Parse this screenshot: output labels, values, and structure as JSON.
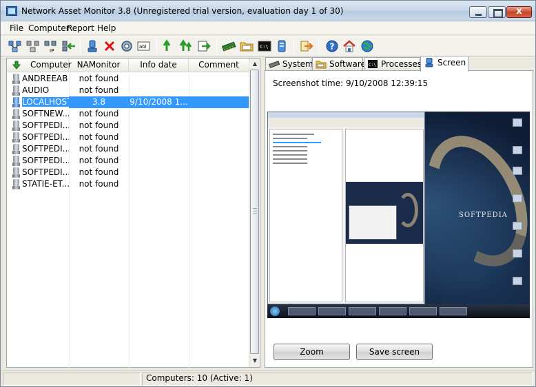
{
  "window": {
    "title": "Network Asset Monitor 3.8 (Unregistered trial version, evaluation day 1 of 30)",
    "close_glyph": "x"
  },
  "menu": [
    "File",
    "Computer",
    "Report",
    "Help"
  ],
  "toolbar": {
    "icons": [
      "network-scan-icon",
      "remove-computers-icon",
      "add-by-ip-icon",
      "import-computers-icon",
      "computer-icon",
      "delete-icon",
      "settings-icon",
      "rename-icon",
      "refresh-icon",
      "refresh-all-icon",
      "export-icon",
      "memory-icon",
      "folder-icon",
      "console-icon",
      "server-icon",
      "exit-icon",
      "help-icon",
      "home-icon",
      "web-icon"
    ]
  },
  "list": {
    "columns": [
      "Computer",
      "NAMonitor",
      "Info date",
      "Comment"
    ],
    "rows": [
      {
        "computer": "ANDREEAB",
        "namonitor": "not found",
        "info_date": "",
        "comment": "",
        "selected": false
      },
      {
        "computer": "AUDIO",
        "namonitor": "not found",
        "info_date": "",
        "comment": "",
        "selected": false
      },
      {
        "computer": "LOCALHOST",
        "namonitor": "3.8",
        "info_date": "9/10/2008 1...",
        "comment": "",
        "selected": true
      },
      {
        "computer": "SOFTNEW...",
        "namonitor": "not found",
        "info_date": "",
        "comment": "",
        "selected": false
      },
      {
        "computer": "SOFTPEDI...",
        "namonitor": "not found",
        "info_date": "",
        "comment": "",
        "selected": false
      },
      {
        "computer": "SOFTPEDI...",
        "namonitor": "not found",
        "info_date": "",
        "comment": "",
        "selected": false
      },
      {
        "computer": "SOFTPEDI...",
        "namonitor": "not found",
        "info_date": "",
        "comment": "",
        "selected": false
      },
      {
        "computer": "SOFTPEDI...",
        "namonitor": "not found",
        "info_date": "",
        "comment": "",
        "selected": false
      },
      {
        "computer": "SOFTPEDI...",
        "namonitor": "not found",
        "info_date": "",
        "comment": "",
        "selected": false
      },
      {
        "computer": "STATIE-ET...",
        "namonitor": "not found",
        "info_date": "",
        "comment": "",
        "selected": false
      }
    ]
  },
  "tabs": [
    {
      "label": "System",
      "icon": "memory-icon",
      "active": false
    },
    {
      "label": "Software",
      "icon": "folder-icon",
      "active": false
    },
    {
      "label": "Processes",
      "icon": "console-icon",
      "active": false
    },
    {
      "label": "Screen",
      "icon": "computer-icon",
      "active": true
    }
  ],
  "screen_panel": {
    "screenshot_time": "Screenshot time: 9/10/2008 12:39:15",
    "preview_caption": "SOFTPEDIA",
    "zoom_label": "Zoom",
    "save_label": "Save screen"
  },
  "status": {
    "computers": "Computers: 10 (Active: 1)"
  },
  "colors": {
    "selection": "#3399ff",
    "close_button": "#c6452a",
    "window_bg": "#ece9e0"
  }
}
